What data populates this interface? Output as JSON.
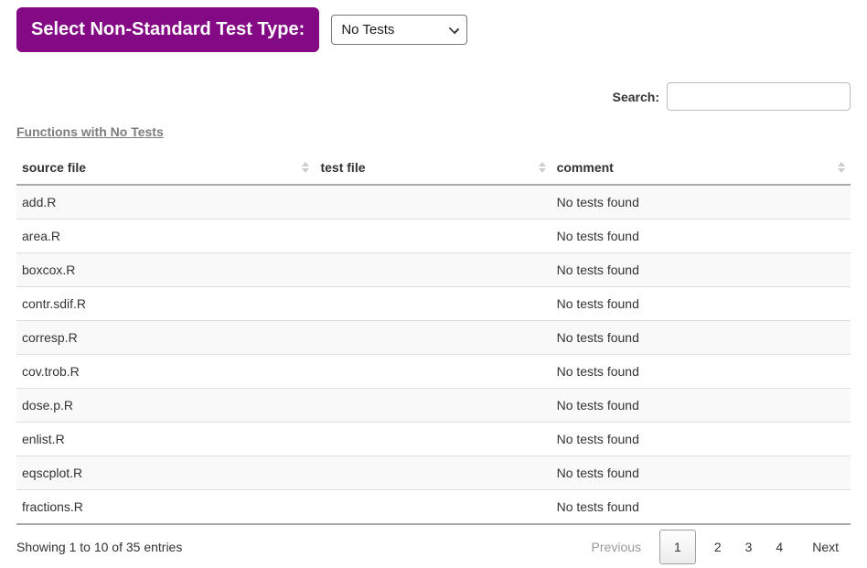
{
  "header": {
    "label": "Select Non-Standard Test Type:",
    "select_value": "No Tests"
  },
  "search": {
    "label": "Search:",
    "value": ""
  },
  "section_link_label": "Functions with No Tests",
  "table": {
    "columns": [
      "source file",
      "test file",
      "comment"
    ],
    "rows": [
      {
        "source_file": "add.R",
        "test_file": "",
        "comment": "No tests found"
      },
      {
        "source_file": "area.R",
        "test_file": "",
        "comment": "No tests found"
      },
      {
        "source_file": "boxcox.R",
        "test_file": "",
        "comment": "No tests found"
      },
      {
        "source_file": "contr.sdif.R",
        "test_file": "",
        "comment": "No tests found"
      },
      {
        "source_file": "corresp.R",
        "test_file": "",
        "comment": "No tests found"
      },
      {
        "source_file": "cov.trob.R",
        "test_file": "",
        "comment": "No tests found"
      },
      {
        "source_file": "dose.p.R",
        "test_file": "",
        "comment": "No tests found"
      },
      {
        "source_file": "enlist.R",
        "test_file": "",
        "comment": "No tests found"
      },
      {
        "source_file": "eqscplot.R",
        "test_file": "",
        "comment": "No tests found"
      },
      {
        "source_file": "fractions.R",
        "test_file": "",
        "comment": "No tests found"
      }
    ]
  },
  "footer": {
    "info": "Showing 1 to 10 of 35 entries",
    "pagination": {
      "previous": "Previous",
      "pages": [
        "1",
        "2",
        "3",
        "4"
      ],
      "current_page": "1",
      "next": "Next"
    }
  },
  "icons": {
    "select_chevron": "chevron-down",
    "column_sort": "sort-up-down"
  },
  "colors": {
    "accent_purple": "#840984",
    "row_stripe": "#f9f9f9",
    "table_border": "#ababab",
    "row_border": "#dddddd",
    "link_gray": "#7d7d7d",
    "disabled_gray": "#999999",
    "sort_icon": "#cdcdcd",
    "text": "#333333"
  }
}
